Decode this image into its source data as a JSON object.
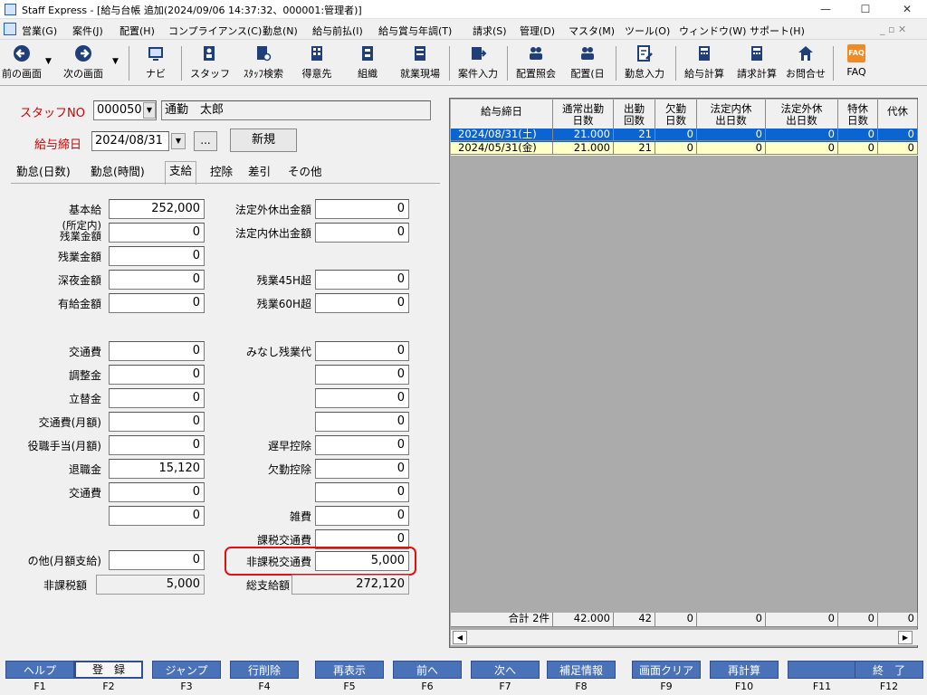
{
  "window": {
    "title": "Staff Express - [給与台帳 追加(2024/09/06 14:37:32、000001:管理者)]",
    "minimize": "—",
    "maximize": "☐",
    "close": "✕"
  },
  "menu": [
    "営業(G)",
    "案件(J)",
    "配置(H)",
    "コンプライアンス(C)",
    "勤怠(N)",
    "給与前払(I)",
    "給与賞与年調(T)",
    "請求(S)",
    "管理(D)",
    "マスタ(M)",
    "ツール(O)",
    "ウィンドウ(W)",
    "サポート(H)"
  ],
  "mdi_controls": "_ ▫ ✕",
  "toolbar": {
    "prev": "前の画面",
    "next": "次の画面",
    "navi": "ナビ",
    "staff": "スタッフ",
    "staff_search": "ｽﾀｯﾌ検索",
    "customer": "得意先",
    "org": "組織",
    "site": "就業現場",
    "case_input": "案件入力",
    "assign_query": "配置照会",
    "assign_day": "配置(日",
    "attendance_input": "勤怠入力",
    "pay_calc": "給与計算",
    "bill_calc": "請求計算",
    "inquiry": "お問合せ",
    "faq": "FAQ",
    "faq_badge": "FAQ"
  },
  "header": {
    "staff_no_label": "スタッフNO",
    "staff_no": "000050",
    "staff_name": "通勤　太郎",
    "pay_date_label": "給与締日",
    "pay_date": "2024/08/31",
    "ellipsis": "...",
    "new_button": "新規"
  },
  "tabs": [
    "勤怠(日数)",
    "勤怠(時間)",
    "支給",
    "控除",
    "差引",
    "その他"
  ],
  "left_fields": [
    {
      "label": "基本給",
      "value": "252,000"
    },
    {
      "label": "(所定内)\n残業金額",
      "value": "0"
    },
    {
      "label": "残業金額",
      "value": "0"
    },
    {
      "label": "深夜金額",
      "value": "0"
    },
    {
      "label": "有給金額",
      "value": "0"
    },
    {
      "label": "交通費",
      "value": "0"
    },
    {
      "label": "調整金",
      "value": "0"
    },
    {
      "label": "立替金",
      "value": "0"
    },
    {
      "label": "交通費(月額)",
      "value": "0"
    },
    {
      "label": "役職手当(月額)",
      "value": "0"
    },
    {
      "label": "退職金",
      "value": "15,120"
    },
    {
      "label": "交通費",
      "value": "0"
    },
    {
      "label": "",
      "value": "0"
    },
    {
      "label": "の他(月額支給)",
      "value": "0"
    }
  ],
  "right_fields": [
    {
      "label": "法定外休出金額",
      "value": "0"
    },
    {
      "label": "法定内休出金額",
      "value": "0"
    },
    {
      "label": "残業45H超",
      "value": "0"
    },
    {
      "label": "残業60H超",
      "value": "0"
    },
    {
      "label": "みなし残業代",
      "value": "0"
    },
    {
      "label": "",
      "value": "0"
    },
    {
      "label": "",
      "value": "0"
    },
    {
      "label": "",
      "value": "0"
    },
    {
      "label": "遅早控除",
      "value": "0"
    },
    {
      "label": "欠勤控除",
      "value": "0"
    },
    {
      "label": "",
      "value": "0"
    },
    {
      "label": "雑費",
      "value": "0"
    },
    {
      "label": "課税交通費",
      "value": "0"
    },
    {
      "label": "非課税交通費",
      "value": "5,000"
    }
  ],
  "totals": {
    "nontax_label": "非課税額",
    "nontax_value": "5,000",
    "total_label": "総支給額",
    "total_value": "272,120"
  },
  "grid": {
    "headers": [
      "給与締日",
      "通常出勤\n日数",
      "出勤\n回数",
      "欠勤\n日数",
      "法定内休\n出日数",
      "法定外休\n出日数",
      "特休\n日数",
      "代休"
    ],
    "rows": [
      [
        "2024/08/31(土)",
        "21.000",
        "21",
        "0",
        "0",
        "0",
        "0",
        "0"
      ],
      [
        "2024/05/31(金)",
        "21.000",
        "21",
        "0",
        "0",
        "0",
        "0",
        "0"
      ]
    ],
    "footer": [
      "合計 2件",
      "42.000",
      "42",
      "0",
      "0",
      "0",
      "0",
      "0"
    ],
    "scroll_left": "◀",
    "scroll_right": "▶"
  },
  "fkeys": [
    {
      "label": "ヘルプ",
      "key": "F1"
    },
    {
      "label": "登　録",
      "key": "F2"
    },
    {
      "label": "ジャンプ",
      "key": "F3"
    },
    {
      "label": "行削除",
      "key": "F4"
    },
    {
      "label": "再表示",
      "key": "F5"
    },
    {
      "label": "前へ",
      "key": "F6"
    },
    {
      "label": "次へ",
      "key": "F7"
    },
    {
      "label": "補足情報",
      "key": "F8"
    },
    {
      "label": "画面クリア",
      "key": "F9"
    },
    {
      "label": "再計算",
      "key": "F10"
    },
    {
      "label": "",
      "key": "F11"
    },
    {
      "label": "終　了",
      "key": "F12"
    }
  ],
  "colors": {
    "accent": "#4a72b8",
    "selected_row": "#0a64d2",
    "alt_row": "#ffffc8",
    "highlight": "#e01010",
    "red_label": "#d00000"
  }
}
